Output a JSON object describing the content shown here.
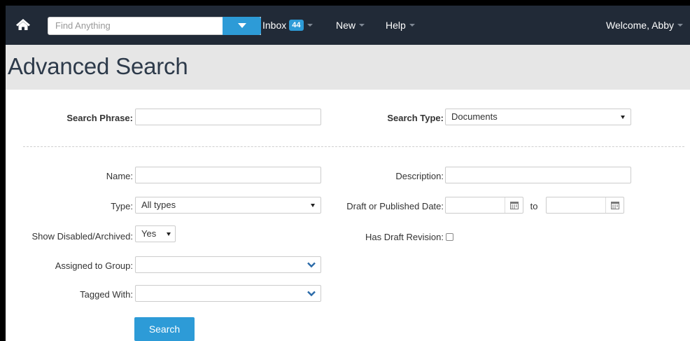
{
  "topbar": {
    "search_placeholder": "Find Anything",
    "inbox_label": "Inbox",
    "inbox_count": "44",
    "new_label": "New",
    "help_label": "Help",
    "welcome_label": "Welcome, Abby",
    "icons": {
      "home": "home-icon",
      "search_dropdown": "caret-down-icon"
    }
  },
  "page": {
    "title": "Advanced Search"
  },
  "form": {
    "search_phrase_label": "Search Phrase:",
    "search_phrase_value": "",
    "search_type_label": "Search Type:",
    "search_type_value": "Documents",
    "name_label": "Name:",
    "name_value": "",
    "description_label": "Description:",
    "description_value": "",
    "type_label": "Type:",
    "type_value": "All types",
    "date_label": "Draft or Published Date:",
    "date_from": "",
    "date_to_label": "to",
    "date_to": "",
    "show_disabled_label": "Show Disabled/Archived:",
    "show_disabled_value": "Yes",
    "has_draft_label": "Has Draft Revision:",
    "has_draft_checked": false,
    "assigned_group_label": "Assigned to Group:",
    "assigned_group_value": "",
    "tagged_with_label": "Tagged With:",
    "tagged_with_value": "",
    "search_button_label": "Search"
  },
  "colors": {
    "topbar_bg": "#212a37",
    "accent": "#2d9bd7",
    "header_bg": "#e6e6e6",
    "title": "#2d3a4a"
  }
}
